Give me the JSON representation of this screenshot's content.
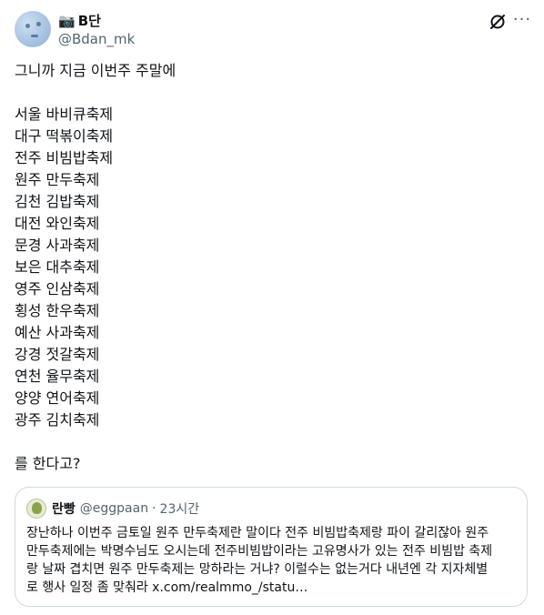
{
  "tweet": {
    "avatar_icon": "user-avatar",
    "badge_icon": "camera-icon",
    "display_name": "B단",
    "handle": "@Bdan_mk",
    "lines": [
      "그니까 지금 이번주 주말에",
      "",
      "서울 바비큐축제",
      "대구 떡볶이축제",
      "전주 비빔밥축제",
      "원주 만두축제",
      "김천 김밥축제",
      "대전 와인축제",
      "문경 사과축제",
      "보은 대추축제",
      "영주 인삼축제",
      "횡성 한우축제",
      "예산 사과축제",
      "강경 젓갈축제",
      "연천 율무축제",
      "양양 연어축제",
      "광주 김치축제",
      "",
      "를 한다고?"
    ]
  },
  "quote": {
    "avatar_icon": "quoted-user-avatar",
    "display_name": "란빵",
    "handle": "@eggpaan",
    "separator": "·",
    "time": "23시간",
    "lines": [
      "장난하나 이번주 금토일 원주 만두축제란 말이다 전주 비빔밥축제랑 파이 갈리잖아 원주",
      "만두축제에는 박명수님도 오시는데 전주비빔밥이라는 고유명사가 있는 전주 비빔밥 축제",
      "랑 날짜 겹치면 원주 만두축제는 망하라는 거냐? 이럴수는 없는거다 내년엔 각 지자체별",
      "로 행사 일정 좀 맞춰라 x.com/realmmo_/statu…"
    ]
  },
  "actions": {
    "grok_icon": "grok-icon",
    "more_icon": "more-options-icon",
    "more_glyph": "···"
  }
}
